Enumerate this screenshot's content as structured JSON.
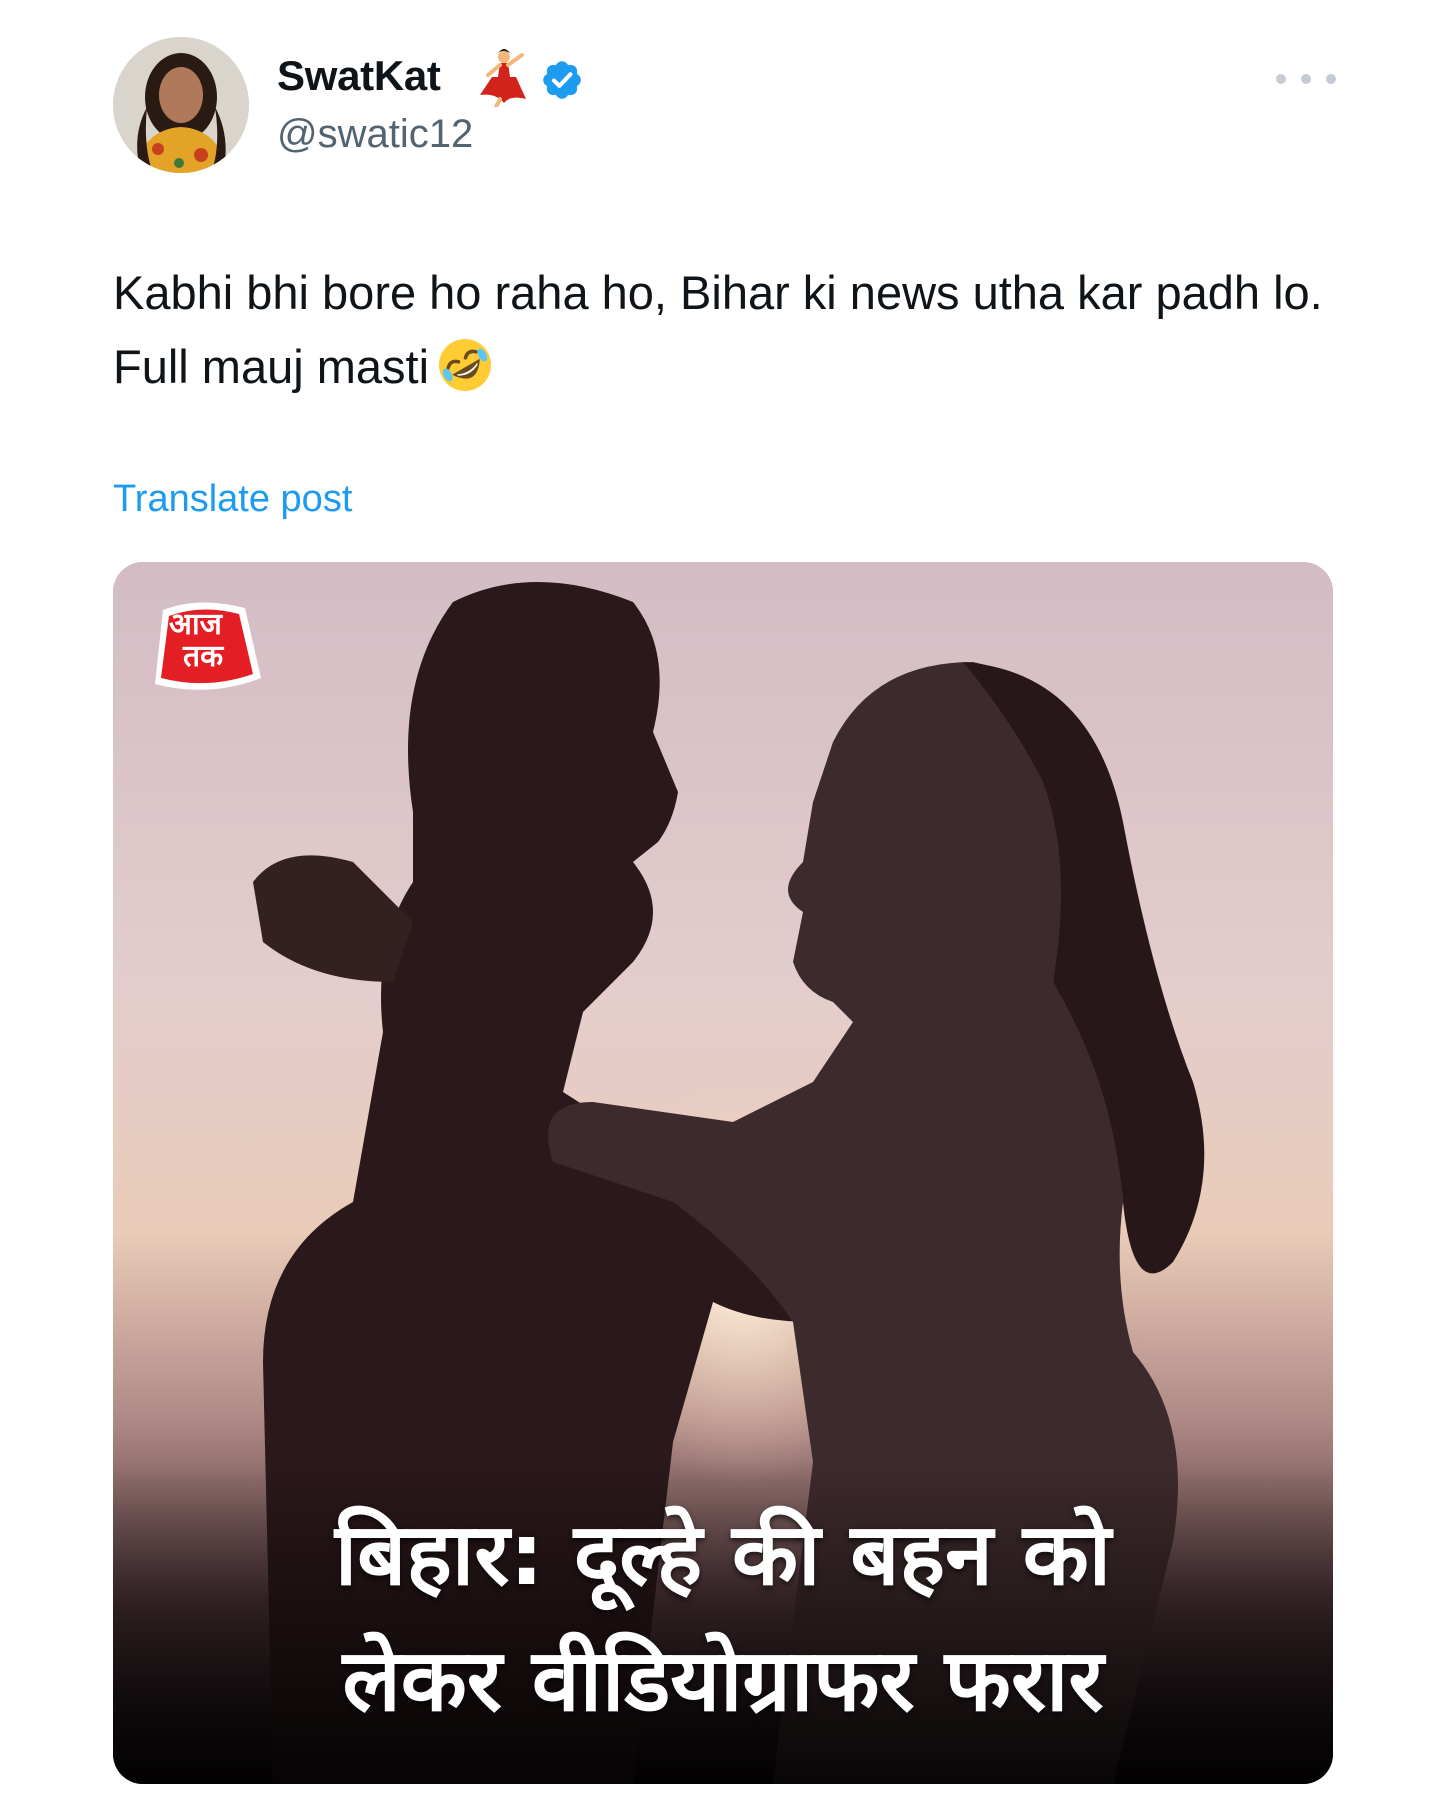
{
  "author": {
    "display_name": "SwatKat",
    "handle": "@swatic12",
    "verified": true,
    "name_emoji": "dancer-emoji",
    "avatar": "profile-photo"
  },
  "post": {
    "text": "Kabhi bhi bore ho raha ho, Bihar ki news utha kar padh lo. Full mauj masti",
    "emoji": "rolling-on-floor-laughing-emoji",
    "translate_label": "Translate post"
  },
  "media": {
    "logo_line1": "आज",
    "logo_line2": "तक",
    "headline_line1": "बिहार: दूल्हे की बहन को",
    "headline_line2": "लेकर वीडियोग्राफर फरार"
  },
  "colors": {
    "text": "#0f1419",
    "secondary": "#536471",
    "link": "#1d9bf0",
    "verified": "#1d9bf0",
    "logo_red": "#e31e24"
  }
}
